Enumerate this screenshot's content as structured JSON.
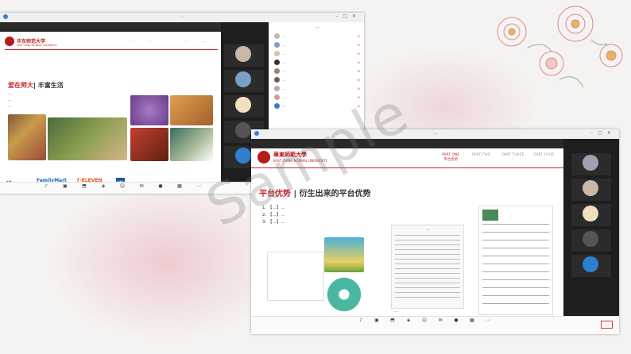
{
  "watermark": "Sample",
  "window1": {
    "title": "...",
    "slide": {
      "uni_cn": "华东师范大学",
      "uni_en": "EAST CHINA NORMAL UNIVERSITY",
      "nav": [
        "...",
        "...",
        "...",
        "...",
        "..."
      ],
      "headline_red": "爱在师大",
      "headline_rest": "| 丰富生活",
      "body": [
        "...",
        "...",
        "..."
      ],
      "logos": [
        "...",
        "FamilyMart",
        "7-ELEVEN",
        "..."
      ]
    },
    "participants": {
      "header": "...",
      "rows": [
        "...",
        "...",
        "...",
        "...",
        "...",
        "...",
        "...",
        "...",
        "..."
      ]
    },
    "toolbar": [
      {
        "icon": "mic-icon",
        "glyph": "♪"
      },
      {
        "icon": "video-icon",
        "glyph": "▣"
      },
      {
        "icon": "share-icon",
        "glyph": "⬒"
      },
      {
        "icon": "security-icon",
        "glyph": "◈"
      },
      {
        "icon": "participants-icon",
        "glyph": "☺"
      },
      {
        "icon": "chat-icon",
        "glyph": "✉"
      },
      {
        "icon": "record-icon",
        "glyph": "●"
      },
      {
        "icon": "apps-icon",
        "glyph": "▦"
      },
      {
        "icon": "more-icon",
        "glyph": "⋯"
      }
    ]
  },
  "window2": {
    "title": "...",
    "slide": {
      "uni_cn": "華東師範大學",
      "uni_en": "EAST CHINA NORMAL UNIVERSITY",
      "parts": [
        {
          "en": "PART ONE",
          "cn": "平台优势",
          "active": true
        },
        {
          "en": "PART TWO",
          "cn": "...",
          "active": false
        },
        {
          "en": "PART THREE",
          "cn": "...",
          "active": false
        },
        {
          "en": "PART FOUR",
          "cn": "...",
          "active": false
        }
      ],
      "headline_red": "平台优势",
      "headline_rest": "| 衍生出来的平台优势",
      "list": [
        "1.  【...】...",
        "2.  【...】...",
        "3.  【...】..."
      ],
      "card_title": "...",
      "card_footer": "..."
    },
    "end_button": "..."
  }
}
